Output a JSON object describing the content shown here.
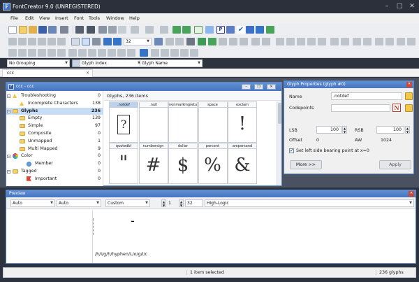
{
  "app": {
    "title": "FontCreator 9.0 (UNREGISTERED)",
    "icon": "fontcreator-app-icon"
  },
  "menu": [
    "File",
    "Edit",
    "View",
    "Insert",
    "Font",
    "Tools",
    "Window",
    "Help"
  ],
  "toolbar": {
    "zoom_value": "32",
    "grouping": "No Grouping",
    "sort_index": "Glyph Index",
    "sort_name": "Glyph Name"
  },
  "doc_tab": {
    "label": "ccc"
  },
  "font_window": {
    "title": "ccc - ccc",
    "header": "Glyphs, 236 items",
    "tree": [
      {
        "label": "Troubleshooting",
        "count": "0",
        "icon": "warning-icon",
        "indent": 0
      },
      {
        "label": "Incomplete Characters",
        "count": "138",
        "icon": "warning-icon",
        "indent": 1
      },
      {
        "label": "Glyphs",
        "count": "236",
        "icon": "folder-icon",
        "indent": 0,
        "selected": true,
        "bold": true
      },
      {
        "label": "Empty",
        "count": "139",
        "icon": "folder-icon",
        "indent": 1
      },
      {
        "label": "Simple",
        "count": "97",
        "icon": "folder-icon",
        "indent": 1
      },
      {
        "label": "Composite",
        "count": "0",
        "icon": "folder-icon",
        "indent": 1
      },
      {
        "label": "Unmapped",
        "count": "1",
        "icon": "folder-icon",
        "indent": 1
      },
      {
        "label": "Multi Mapped",
        "count": "9",
        "icon": "folder-icon",
        "indent": 1
      },
      {
        "label": "Color",
        "count": "0",
        "icon": "color-wheel-icon",
        "indent": 0
      },
      {
        "label": "Member",
        "count": "0",
        "icon": "color-dot-icon",
        "indent": 2
      },
      {
        "label": "Tagged",
        "count": "0",
        "icon": "folder-icon",
        "indent": 0
      },
      {
        "label": "Important",
        "count": "0",
        "icon": "flag-icon",
        "indent": 2
      }
    ],
    "glyph_row1": [
      {
        "name": ".notdef",
        "char": "?",
        "boxed": true,
        "selected": true
      },
      {
        "name": ".null",
        "char": ""
      },
      {
        "name": "nonmarkingretu...",
        "char": ""
      },
      {
        "name": "space",
        "char": ""
      },
      {
        "name": "exclam",
        "char": "!"
      }
    ],
    "glyph_row2": [
      {
        "name": "quotedbl",
        "char": "\""
      },
      {
        "name": "numbersign",
        "char": "#"
      },
      {
        "name": "dollar",
        "char": "$"
      },
      {
        "name": "percent",
        "char": "%"
      },
      {
        "name": "ampersand",
        "char": "&"
      }
    ]
  },
  "glyph_props": {
    "title": "Glyph Properties (glyph #0)",
    "name_label": "Name",
    "name_value": ".notdef",
    "codepoints_label": "Codepoints",
    "codepoints_value": "",
    "lsb_label": "LSB",
    "lsb_value": "100",
    "rsb_label": "RSB",
    "rsb_value": "100",
    "offset_label": "Offset",
    "offset_value": "0",
    "aw_label": "AW",
    "aw_value": "1024",
    "checkbox_label": "Set left side bearing point at x=0",
    "more_button": "More >>",
    "apply_button": "Apply"
  },
  "preview": {
    "title": "Preview",
    "combo1": "Auto",
    "combo2": "Auto",
    "combo3": "Custom",
    "stepper1": "1",
    "stepper2": "32",
    "hinting": "High-Logic",
    "sample_glyph": "-",
    "text": "/h/i/g/h/hyphen/L/o/g/i/c"
  },
  "status": {
    "selection": "1 item selected",
    "count": "236 glyphs"
  },
  "colors": {
    "accent": "#4775bf",
    "folder": "#f1cf6a",
    "selection": "#c7dcf5",
    "warning": "#f5c542"
  }
}
